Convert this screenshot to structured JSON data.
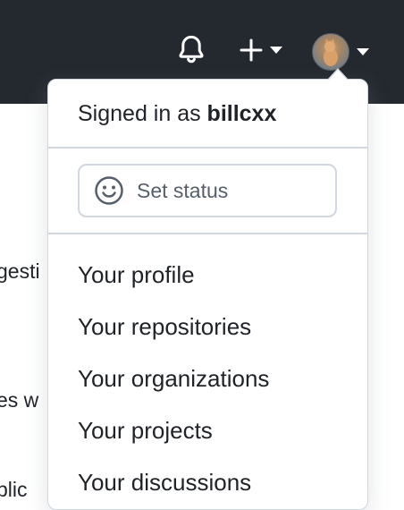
{
  "header": {
    "bell_icon": "bell-icon",
    "create_icon": "plus-icon",
    "avatar_alt": "user-avatar"
  },
  "background": {
    "frag1": "gesti",
    "frag2": "es w",
    "frag3": "blic"
  },
  "dropdown": {
    "signed_in_prefix": "Signed in as ",
    "username": "billcxx",
    "set_status_label": "Set status",
    "items": [
      {
        "label": "Your profile"
      },
      {
        "label": "Your repositories"
      },
      {
        "label": "Your organizations"
      },
      {
        "label": "Your projects"
      },
      {
        "label": "Your discussions"
      }
    ]
  },
  "colors": {
    "header_bg": "#24292f",
    "border": "#d0d7de",
    "text": "#1f2328",
    "muted_text": "#57606a"
  }
}
